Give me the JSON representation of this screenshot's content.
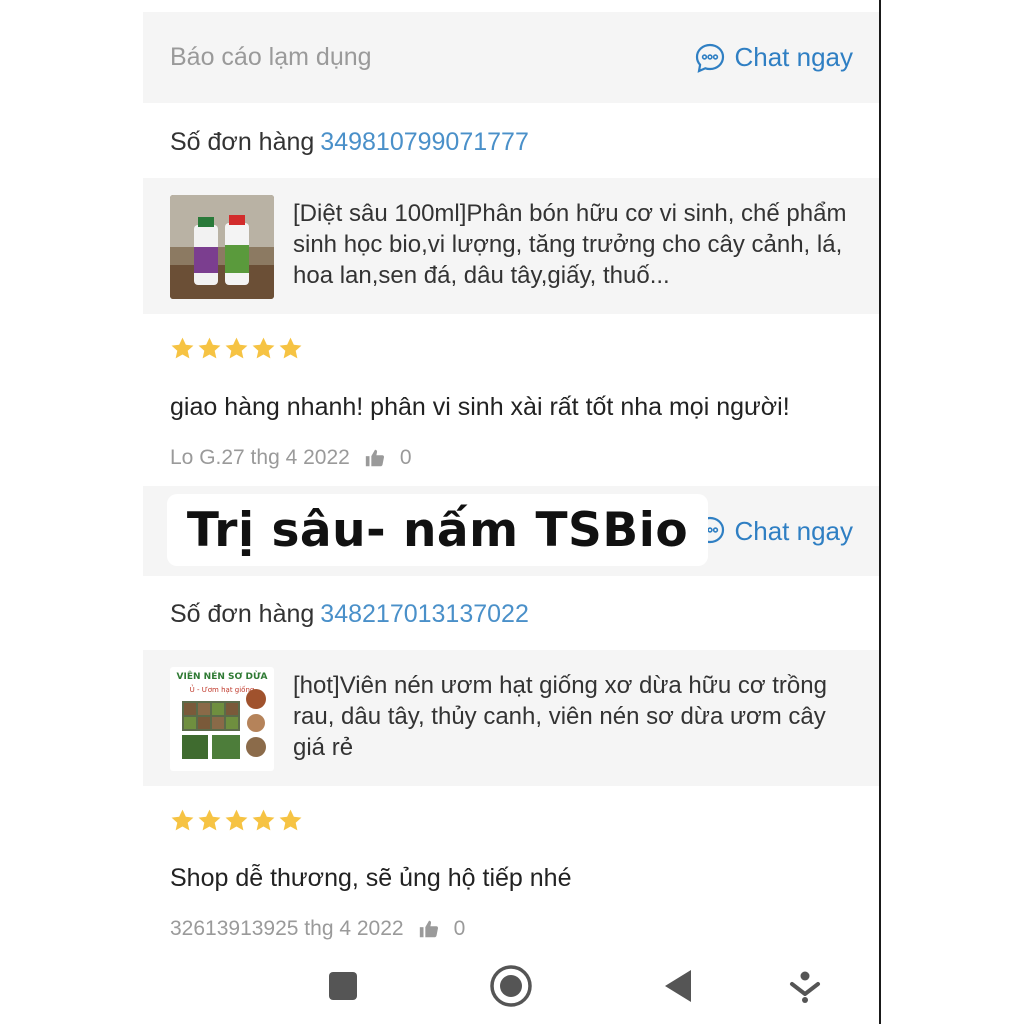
{
  "block1": {
    "report_label": "Báo cáo lạm dụng",
    "chat_label": "Chat ngay",
    "order_label": "Số đơn hàng",
    "order_number": "349810799071777",
    "product_title": "[Diệt sâu 100ml]Phân bón hữu cơ vi sinh, chế phẩm sinh học bio,vi lượng, tăng trưởng cho cây cảnh, lá, hoa lan,sen đá, dâu tây,giấy, thuố...",
    "rating": 5,
    "review_text": "giao hàng nhanh! phân vi sinh xài rất tốt nha mọi người!",
    "meta_text": "Lo G.27 thg 4 2022",
    "likes": "0"
  },
  "block2": {
    "chat_label": "Chat ngay",
    "order_label": "Số đơn hàng",
    "order_number": "348217013137022",
    "product_title": "[hot]Viên nén ươm hạt giống xơ dừa hữu cơ trồng rau, dâu tây, thủy canh, viên nén sơ dừa ươm cây giá rẻ",
    "thumb_title": "VIÊN NÉN SƠ DỪA",
    "thumb_subtitle": "Ủ - Ươm hạt giống",
    "rating": 5,
    "review_text": "Shop dễ thương, sẽ ủng hộ tiếp nhé",
    "meta_text": "32613913925 thg 4 2022",
    "likes": "0"
  },
  "overlay_caption": "Trị sâu- nấm TSBio",
  "colors": {
    "accent_blue": "#2f7fc3",
    "order_blue": "#4a90c9",
    "star": "#f6c343",
    "gray_bg": "#f5f5f5"
  },
  "navbar": {
    "icons": [
      "square-icon",
      "circle-home-icon",
      "back-triangle-icon",
      "assist-icon"
    ]
  }
}
